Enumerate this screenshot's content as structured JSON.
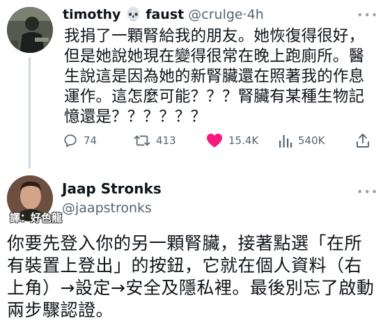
{
  "tweet1": {
    "display_name": "timothy",
    "emoji": "💀",
    "display_name_2": "faust",
    "handle": "@crulge",
    "separator": "·",
    "time": "4h",
    "text": "我捐了一顆腎給我的朋友。她恢復得很好，但是她說她現在變得很常在晚上跑廁所。醫生說這是因為她的新腎臟還在照著我的作息運作。這怎麼可能？？？腎臟有某種生物記憶還是？？？？？？",
    "stats": {
      "replies": "74",
      "retweets": "413",
      "likes": "15.4K",
      "views": "540K"
    },
    "like_color": "#f91880"
  },
  "tweet2": {
    "display_name": "Jaap Stronks",
    "handle": "@jaapstronks",
    "watermark": "譯：好色龍",
    "text": "你要先登入你的另一顆腎臟，接著點選「在所有裝置上登出」的按鈕，它就在個人資料（右上角）→設定→安全及隱私裡。最後別忘了啟動兩步驟認證。"
  }
}
